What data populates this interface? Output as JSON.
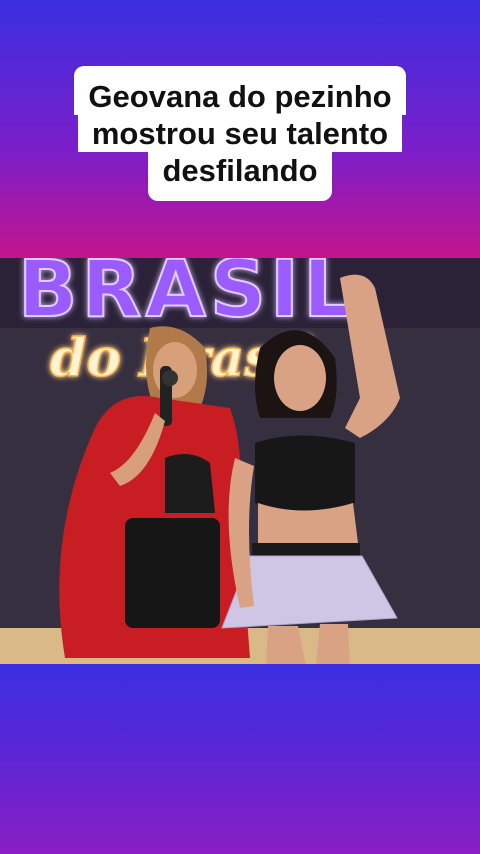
{
  "caption": {
    "line1": "Geovana do pezinho",
    "line2": "mostrou seu talento",
    "line3": "desfilando"
  },
  "photo": {
    "sign_top": "BRASIL",
    "sign_script": "do Brasil"
  },
  "colors": {
    "top_gradient": "#3a2fe0",
    "magenta": "#c3148e",
    "bottom_gradient": "#3b2fe3",
    "neon_purple": "#7a3cff",
    "neon_warm": "#ffcf6a"
  }
}
